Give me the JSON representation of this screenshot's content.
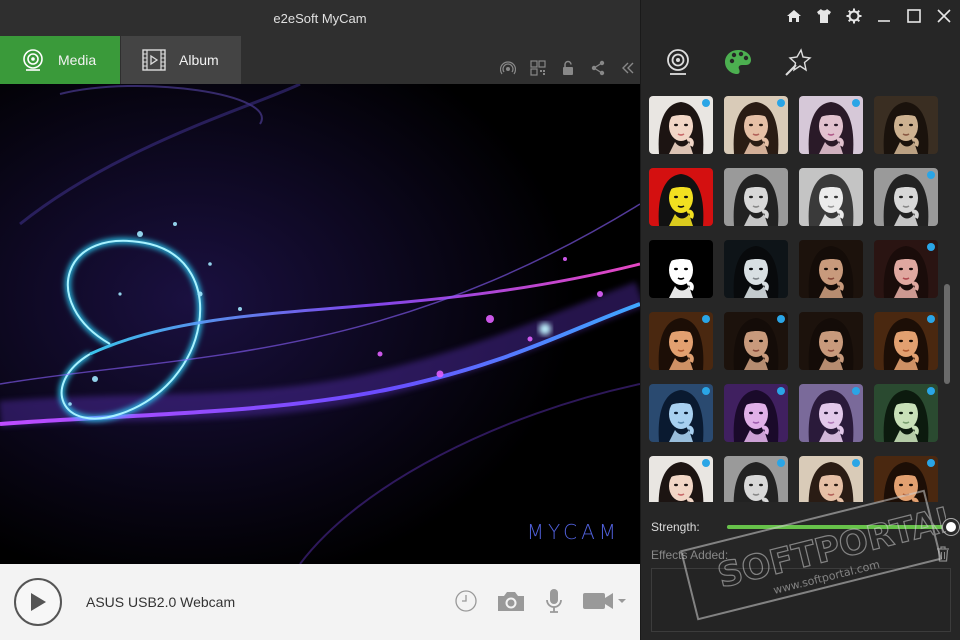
{
  "window": {
    "title": "e2eSoft MyCam"
  },
  "tabs": [
    {
      "label": "Media",
      "icon": "webcam-icon",
      "active": true
    },
    {
      "label": "Album",
      "icon": "film-icon",
      "active": false
    }
  ],
  "toolbar_icons": [
    "broadcast-icon",
    "qr-code-icon",
    "lock-icon",
    "share-icon",
    "collapse-icon"
  ],
  "preview": {
    "brand_text": "MYCAM"
  },
  "bottombar": {
    "device_name": "ASUS USB2.0 Webcam",
    "icons": [
      "timer-icon",
      "camera-icon",
      "microphone-icon",
      "video-camera-icon"
    ]
  },
  "right_panel": {
    "window_controls": [
      "home-icon",
      "shirt-icon",
      "settings-icon",
      "minimize-icon",
      "maximize-icon",
      "close-icon"
    ],
    "panel_tabs": [
      "webcam-icon",
      "palette-icon",
      "magic-wand-icon"
    ],
    "active_panel_tab": 1,
    "strength_label": "Strength:",
    "strength_value": 1.0,
    "effects_label": "Effects Added:"
  },
  "effects": [
    {
      "filter": "normal",
      "dot": true
    },
    {
      "filter": "warm",
      "dot": true
    },
    {
      "filter": "purple",
      "dot": true
    },
    {
      "filter": "vintage",
      "dot": false
    },
    {
      "filter": "pop",
      "dot": false
    },
    {
      "filter": "gray",
      "dot": false
    },
    {
      "filter": "grayLight",
      "dot": false
    },
    {
      "filter": "gray",
      "dot": true
    },
    {
      "filter": "bw",
      "dot": false
    },
    {
      "filter": "darkBlue",
      "dot": false
    },
    {
      "filter": "dark",
      "dot": false
    },
    {
      "filter": "rose",
      "dot": true
    },
    {
      "filter": "orange",
      "dot": true
    },
    {
      "filter": "dark",
      "dot": true
    },
    {
      "filter": "dark",
      "dot": false
    },
    {
      "filter": "orange",
      "dot": true
    },
    {
      "filter": "blue",
      "dot": true
    },
    {
      "filter": "violet",
      "dot": true
    },
    {
      "filter": "lavender",
      "dot": true
    },
    {
      "filter": "green",
      "dot": true
    },
    {
      "filter": "normal",
      "dot": true
    },
    {
      "filter": "gray",
      "dot": true
    },
    {
      "filter": "warm",
      "dot": true
    },
    {
      "filter": "orange",
      "dot": true
    }
  ],
  "watermark": {
    "text": "SOFTPORTAL",
    "url": "www.softportal.com"
  },
  "colors": {
    "accent_green": "#3a9a3a",
    "slider_green": "#67c24a",
    "dot_blue": "#2aa5e6",
    "brand_blue": "#4f5fd8"
  }
}
